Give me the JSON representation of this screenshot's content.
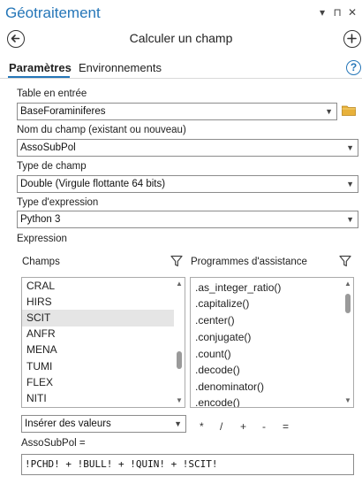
{
  "panel": {
    "title": "Géotraitement",
    "pin_icon": "⊓",
    "close_icon": "✕",
    "menu_icon": "▾"
  },
  "nav": {
    "tool_title": "Calculer un champ"
  },
  "tabs": [
    {
      "label": "Paramètres",
      "active": true
    },
    {
      "label": "Environnements",
      "active": false
    }
  ],
  "params": {
    "input_table_label": "Table en entrée",
    "input_table_value": "BaseForaminiferes",
    "field_name_label": "Nom du champ (existant ou nouveau)",
    "field_name_value": "AssoSubPol",
    "field_type_label": "Type de champ",
    "field_type_value": "Double (Virgule flottante 64 bits)",
    "expression_type_label": "Type d'expression",
    "expression_type_value": "Python 3",
    "expression_label": "Expression"
  },
  "fields_list": {
    "header": "Champs",
    "items": [
      "CRAL",
      "HIRS",
      "SCIT",
      "ANFR",
      "MENA",
      "TUMI",
      "FLEX",
      "NITI"
    ],
    "selected": "SCIT"
  },
  "helpers_list": {
    "header": "Programmes d'assistance",
    "items": [
      ".as_integer_ratio()",
      ".capitalize()",
      ".center()",
      ".conjugate()",
      ".count()",
      ".decode()",
      ".denominator()",
      ".encode()"
    ]
  },
  "insert": {
    "value": "Insérer des valeurs"
  },
  "operators": [
    "*",
    "/",
    "+",
    "-",
    "="
  ],
  "expression": {
    "target_label": "AssoSubPol =",
    "code": "!PCHD! + !BULL! + !QUIN! + !SCIT!"
  },
  "colors": {
    "accent": "#2576b8",
    "folder": "#e8b13a",
    "selection": "#e5e5e5"
  }
}
